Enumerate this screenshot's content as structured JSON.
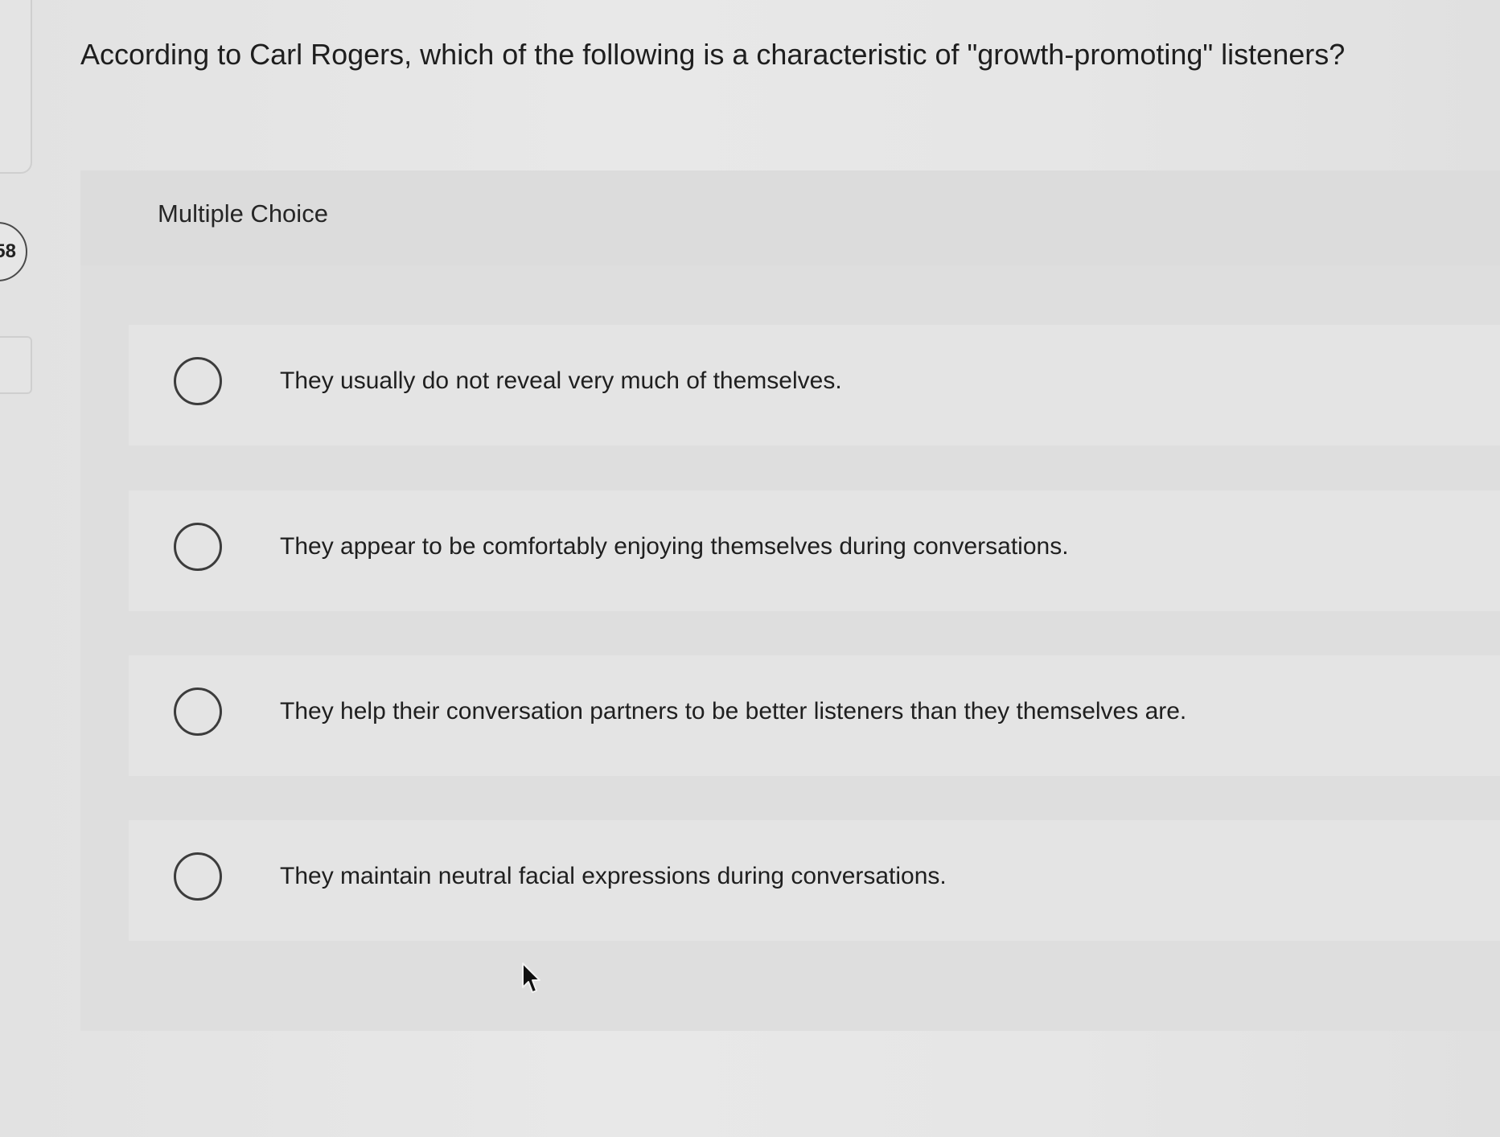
{
  "question": {
    "number": "58",
    "text": "According to Carl Rogers, which of the following is a characteristic of \"growth-promoting\" listeners?"
  },
  "choice_panel": {
    "label": "Multiple Choice",
    "options": [
      {
        "text": "They usually do not reveal very much of themselves.",
        "selected": false
      },
      {
        "text": "They appear to be comfortably enjoying themselves during conversations.",
        "selected": false
      },
      {
        "text": "They help their conversation partners to be better listeners than they themselves are.",
        "selected": false
      },
      {
        "text": "They maintain neutral facial expressions during conversations.",
        "selected": false
      }
    ]
  },
  "colors": {
    "background": "#e6e6e6",
    "panel": "#dedede",
    "option_row": "#e4e4e4",
    "text": "#1f1f1f",
    "radio_border": "#3c3c3c"
  },
  "icons": {
    "radio": "radio-button-unchecked-icon",
    "cursor": "mouse-pointer-icon"
  }
}
